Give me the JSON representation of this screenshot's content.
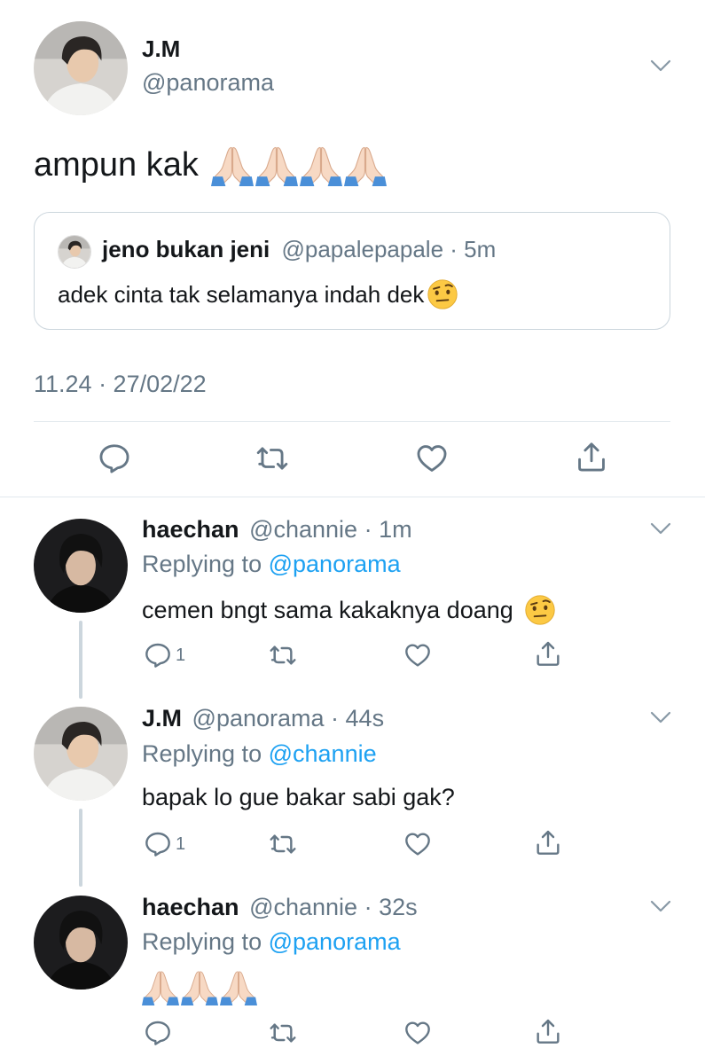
{
  "main_tweet": {
    "author_name": "J.M",
    "author_handle": "@panorama",
    "text": "ampun kak",
    "emoji": "folded-hands-x4",
    "timestamp": "11.24 · 27/02/22",
    "quoted": {
      "author_name": "jeno bukan jeni",
      "author_handle": "@papalepapale",
      "time": "5m",
      "text": "adek cinta tak selamanya indah dek",
      "emoji": "face-with-raised-eyebrow"
    }
  },
  "replies": [
    {
      "author_name": "haechan",
      "author_handle": "@channie",
      "time": "1m",
      "replying_to_label": "Replying to",
      "replying_to_handle": "@panorama",
      "text": "cemen bngt sama kakaknya doang",
      "emoji": "face-with-raised-eyebrow",
      "reply_count": "1"
    },
    {
      "author_name": "J.M",
      "author_handle": "@panorama",
      "time": "44s",
      "replying_to_label": "Replying to",
      "replying_to_handle": "@channie",
      "text": "bapak lo gue bakar sabi gak?",
      "reply_count": "1"
    },
    {
      "author_name": "haechan",
      "author_handle": "@channie",
      "time": "32s",
      "replying_to_label": "Replying to",
      "replying_to_handle": "@panorama",
      "text": "",
      "emoji": "folded-hands-x3",
      "reply_count": ""
    }
  ],
  "separator": " · ",
  "colors": {
    "link": "#1da1f2",
    "muted": "#657786",
    "divider": "#e1e8ed",
    "thread_line": "#ccd6dd"
  }
}
